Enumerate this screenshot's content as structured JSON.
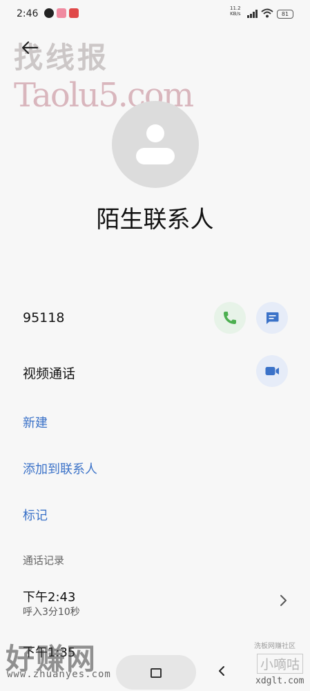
{
  "status_bar": {
    "time": "2:46",
    "net_speed_value": "11.2",
    "net_speed_unit": "KB/s",
    "battery": "81"
  },
  "watermarks": {
    "top_title": "找线报",
    "top_url": "Taolu5.com",
    "bottom_title": "好赚网",
    "bottom_url": "www.zhuanyes.com",
    "bottom_right_tiny": "洗板网赚社区",
    "bottom_right_title": "小嘀咕",
    "bottom_right_url": "xdglt.com"
  },
  "contact": {
    "name": "陌生联系人"
  },
  "phone_row": {
    "number": "95118"
  },
  "video_row": {
    "label": "视频通话"
  },
  "actions": {
    "new": "新建",
    "add_to_contacts": "添加到联系人",
    "mark": "标记"
  },
  "call_log": {
    "title": "通话记录",
    "entries": [
      {
        "time": "下午2:43",
        "detail": "呼入3分10秒"
      },
      {
        "time": "下午1:35"
      }
    ]
  },
  "colors": {
    "accent": "#3b72c8",
    "call_green": "#4caf50",
    "call_green_bg": "#e7f3e8",
    "blue_bg": "#e6ecf8",
    "avatar_bg": "#dcdcdc"
  }
}
